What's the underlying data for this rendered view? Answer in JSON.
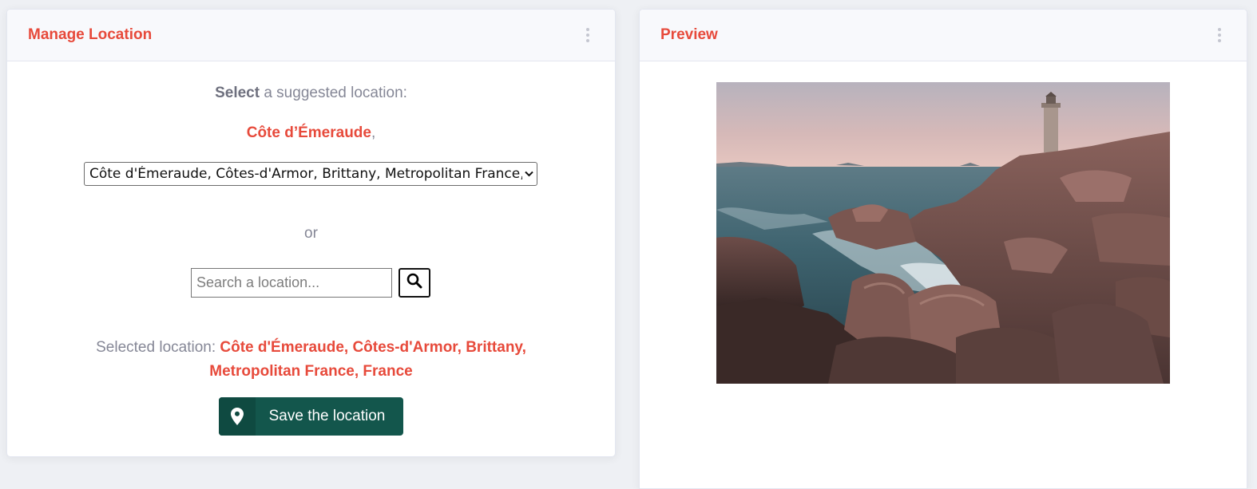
{
  "manage": {
    "title": "Manage Location",
    "select_prompt_bold": "Select",
    "select_prompt_rest": " a suggested location:",
    "suggested_name": "Côte d’Émeraude",
    "suggested_suffix": ",",
    "dropdown_selected": "Côte d'Émeraude, Côtes-d'Armor, Brittany, Metropolitan France, France",
    "or_text": "or",
    "search_placeholder": "Search a location...",
    "selected_label": "Selected location: ",
    "selected_value_line1": "Côte d'Émeraude, Côtes-d'Armor, Brittany,",
    "selected_value_line2": "Metropolitan France, France",
    "save_label": "Save the location"
  },
  "preview": {
    "title": "Preview"
  },
  "colors": {
    "accent": "#e74a3b",
    "save_button": "#13564c",
    "muted_text": "#858796"
  },
  "icons": {
    "menu": "kebab-menu-icon",
    "search": "search-icon",
    "location": "map-marker-icon"
  }
}
